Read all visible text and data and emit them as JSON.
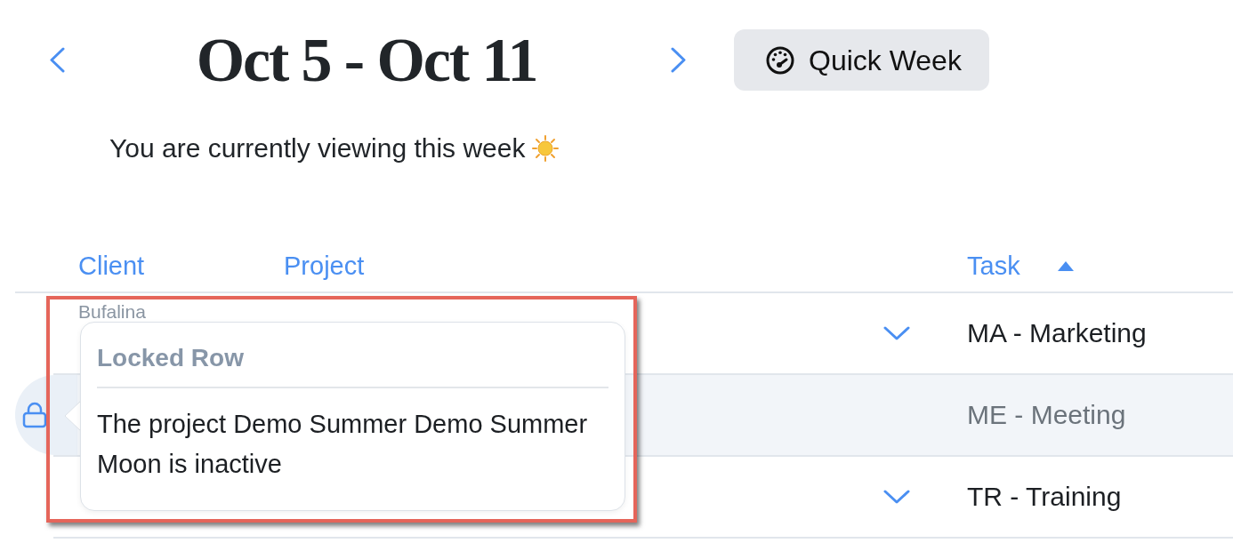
{
  "week_nav": {
    "title": "Oct 5 - Oct 11",
    "quick_week_button": "Quick Week"
  },
  "subtitle": {
    "text": "You are currently viewing this week"
  },
  "table": {
    "columns": [
      {
        "label": "Client",
        "sorted": false
      },
      {
        "label": "Project",
        "sorted": false
      },
      {
        "label": "Task",
        "sorted": true
      }
    ],
    "rows": [
      {
        "client": "Bufalina",
        "task": "MA - Marketing",
        "locked": false
      },
      {
        "task": "ME - Meeting",
        "locked": true
      },
      {
        "task": "TR - Training",
        "locked": false
      }
    ]
  },
  "tooltip": {
    "title": "Locked Row",
    "text": "The project Demo Summer Demo Summer Moon is inactive",
    "highlighted": true
  }
}
